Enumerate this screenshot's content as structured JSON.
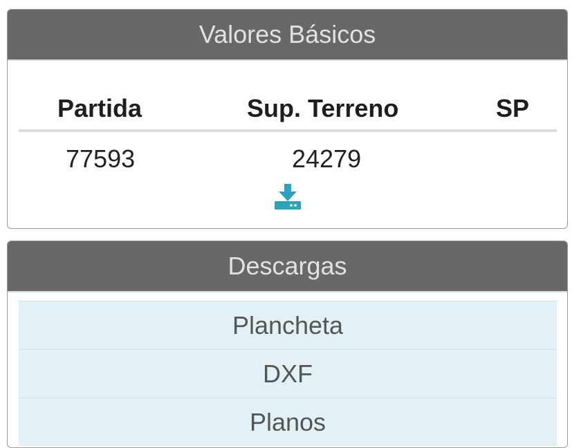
{
  "valores_basicos": {
    "title": "Valores Básicos",
    "columns": [
      "Partida",
      "Sup. Terreno",
      "SP"
    ],
    "row": {
      "partida": "77593",
      "sup_terreno": "24279",
      "sp": ""
    },
    "download_icon": "download-icon",
    "accent_color": "#2aa3bf"
  },
  "descargas": {
    "title": "Descargas",
    "items": [
      "Plancheta",
      "DXF",
      "Planos"
    ]
  }
}
